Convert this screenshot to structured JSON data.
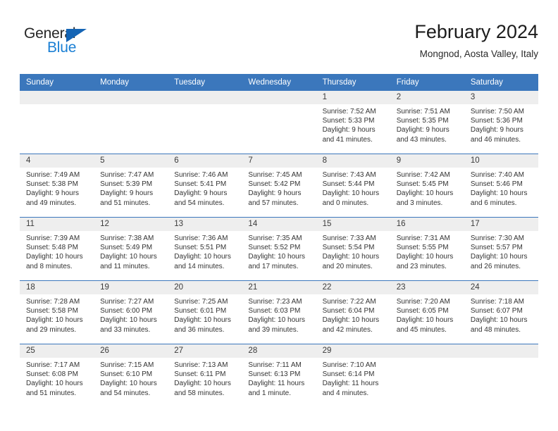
{
  "brand": {
    "word_one": "General",
    "word_two": "Blue",
    "triangle_icon": "triangle-logo-icon",
    "accent_color": "#1565b5",
    "text_color": "#262626"
  },
  "header": {
    "title": "February 2024",
    "location": "Mongnod, Aosta Valley, Italy"
  },
  "theme": {
    "header_blue": "#3b77bc",
    "day_band_gray": "#eeeeee",
    "body_text": "#333333"
  },
  "calendar": {
    "weekdays": [
      "Sunday",
      "Monday",
      "Tuesday",
      "Wednesday",
      "Thursday",
      "Friday",
      "Saturday"
    ],
    "labels": {
      "sunrise": "Sunrise:",
      "sunset": "Sunset:",
      "daylight": "Daylight:"
    },
    "weeks": [
      [
        {
          "day": "",
          "empty": true
        },
        {
          "day": "",
          "empty": true
        },
        {
          "day": "",
          "empty": true
        },
        {
          "day": "",
          "empty": true
        },
        {
          "day": "1",
          "sunrise": "Sunrise: 7:52 AM",
          "sunset": "Sunset: 5:33 PM",
          "daylight_1": "Daylight: 9 hours",
          "daylight_2": "and 41 minutes."
        },
        {
          "day": "2",
          "sunrise": "Sunrise: 7:51 AM",
          "sunset": "Sunset: 5:35 PM",
          "daylight_1": "Daylight: 9 hours",
          "daylight_2": "and 43 minutes."
        },
        {
          "day": "3",
          "sunrise": "Sunrise: 7:50 AM",
          "sunset": "Sunset: 5:36 PM",
          "daylight_1": "Daylight: 9 hours",
          "daylight_2": "and 46 minutes."
        }
      ],
      [
        {
          "day": "4",
          "sunrise": "Sunrise: 7:49 AM",
          "sunset": "Sunset: 5:38 PM",
          "daylight_1": "Daylight: 9 hours",
          "daylight_2": "and 49 minutes."
        },
        {
          "day": "5",
          "sunrise": "Sunrise: 7:47 AM",
          "sunset": "Sunset: 5:39 PM",
          "daylight_1": "Daylight: 9 hours",
          "daylight_2": "and 51 minutes."
        },
        {
          "day": "6",
          "sunrise": "Sunrise: 7:46 AM",
          "sunset": "Sunset: 5:41 PM",
          "daylight_1": "Daylight: 9 hours",
          "daylight_2": "and 54 minutes."
        },
        {
          "day": "7",
          "sunrise": "Sunrise: 7:45 AM",
          "sunset": "Sunset: 5:42 PM",
          "daylight_1": "Daylight: 9 hours",
          "daylight_2": "and 57 minutes."
        },
        {
          "day": "8",
          "sunrise": "Sunrise: 7:43 AM",
          "sunset": "Sunset: 5:44 PM",
          "daylight_1": "Daylight: 10 hours",
          "daylight_2": "and 0 minutes."
        },
        {
          "day": "9",
          "sunrise": "Sunrise: 7:42 AM",
          "sunset": "Sunset: 5:45 PM",
          "daylight_1": "Daylight: 10 hours",
          "daylight_2": "and 3 minutes."
        },
        {
          "day": "10",
          "sunrise": "Sunrise: 7:40 AM",
          "sunset": "Sunset: 5:46 PM",
          "daylight_1": "Daylight: 10 hours",
          "daylight_2": "and 6 minutes."
        }
      ],
      [
        {
          "day": "11",
          "sunrise": "Sunrise: 7:39 AM",
          "sunset": "Sunset: 5:48 PM",
          "daylight_1": "Daylight: 10 hours",
          "daylight_2": "and 8 minutes."
        },
        {
          "day": "12",
          "sunrise": "Sunrise: 7:38 AM",
          "sunset": "Sunset: 5:49 PM",
          "daylight_1": "Daylight: 10 hours",
          "daylight_2": "and 11 minutes."
        },
        {
          "day": "13",
          "sunrise": "Sunrise: 7:36 AM",
          "sunset": "Sunset: 5:51 PM",
          "daylight_1": "Daylight: 10 hours",
          "daylight_2": "and 14 minutes."
        },
        {
          "day": "14",
          "sunrise": "Sunrise: 7:35 AM",
          "sunset": "Sunset: 5:52 PM",
          "daylight_1": "Daylight: 10 hours",
          "daylight_2": "and 17 minutes."
        },
        {
          "day": "15",
          "sunrise": "Sunrise: 7:33 AM",
          "sunset": "Sunset: 5:54 PM",
          "daylight_1": "Daylight: 10 hours",
          "daylight_2": "and 20 minutes."
        },
        {
          "day": "16",
          "sunrise": "Sunrise: 7:31 AM",
          "sunset": "Sunset: 5:55 PM",
          "daylight_1": "Daylight: 10 hours",
          "daylight_2": "and 23 minutes."
        },
        {
          "day": "17",
          "sunrise": "Sunrise: 7:30 AM",
          "sunset": "Sunset: 5:57 PM",
          "daylight_1": "Daylight: 10 hours",
          "daylight_2": "and 26 minutes."
        }
      ],
      [
        {
          "day": "18",
          "sunrise": "Sunrise: 7:28 AM",
          "sunset": "Sunset: 5:58 PM",
          "daylight_1": "Daylight: 10 hours",
          "daylight_2": "and 29 minutes."
        },
        {
          "day": "19",
          "sunrise": "Sunrise: 7:27 AM",
          "sunset": "Sunset: 6:00 PM",
          "daylight_1": "Daylight: 10 hours",
          "daylight_2": "and 33 minutes."
        },
        {
          "day": "20",
          "sunrise": "Sunrise: 7:25 AM",
          "sunset": "Sunset: 6:01 PM",
          "daylight_1": "Daylight: 10 hours",
          "daylight_2": "and 36 minutes."
        },
        {
          "day": "21",
          "sunrise": "Sunrise: 7:23 AM",
          "sunset": "Sunset: 6:03 PM",
          "daylight_1": "Daylight: 10 hours",
          "daylight_2": "and 39 minutes."
        },
        {
          "day": "22",
          "sunrise": "Sunrise: 7:22 AM",
          "sunset": "Sunset: 6:04 PM",
          "daylight_1": "Daylight: 10 hours",
          "daylight_2": "and 42 minutes."
        },
        {
          "day": "23",
          "sunrise": "Sunrise: 7:20 AM",
          "sunset": "Sunset: 6:05 PM",
          "daylight_1": "Daylight: 10 hours",
          "daylight_2": "and 45 minutes."
        },
        {
          "day": "24",
          "sunrise": "Sunrise: 7:18 AM",
          "sunset": "Sunset: 6:07 PM",
          "daylight_1": "Daylight: 10 hours",
          "daylight_2": "and 48 minutes."
        }
      ],
      [
        {
          "day": "25",
          "sunrise": "Sunrise: 7:17 AM",
          "sunset": "Sunset: 6:08 PM",
          "daylight_1": "Daylight: 10 hours",
          "daylight_2": "and 51 minutes."
        },
        {
          "day": "26",
          "sunrise": "Sunrise: 7:15 AM",
          "sunset": "Sunset: 6:10 PM",
          "daylight_1": "Daylight: 10 hours",
          "daylight_2": "and 54 minutes."
        },
        {
          "day": "27",
          "sunrise": "Sunrise: 7:13 AM",
          "sunset": "Sunset: 6:11 PM",
          "daylight_1": "Daylight: 10 hours",
          "daylight_2": "and 58 minutes."
        },
        {
          "day": "28",
          "sunrise": "Sunrise: 7:11 AM",
          "sunset": "Sunset: 6:13 PM",
          "daylight_1": "Daylight: 11 hours",
          "daylight_2": "and 1 minute."
        },
        {
          "day": "29",
          "sunrise": "Sunrise: 7:10 AM",
          "sunset": "Sunset: 6:14 PM",
          "daylight_1": "Daylight: 11 hours",
          "daylight_2": "and 4 minutes."
        },
        {
          "day": "",
          "empty": true
        },
        {
          "day": "",
          "empty": true
        }
      ]
    ]
  }
}
